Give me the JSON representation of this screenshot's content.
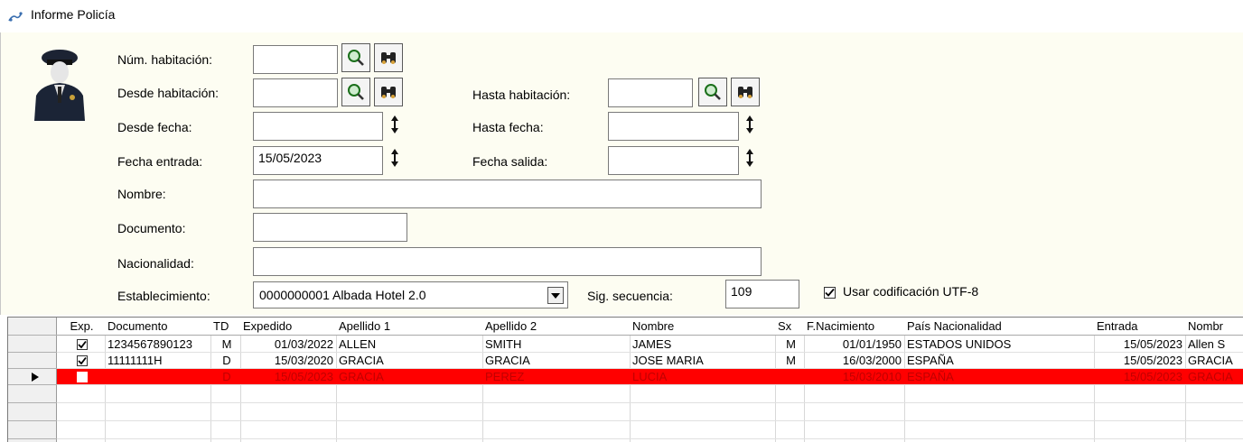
{
  "window": {
    "title": "Informe Policía"
  },
  "form": {
    "labels": {
      "num_habitacion": "Núm. habitación:",
      "desde_habitacion": "Desde habitación:",
      "hasta_habitacion": "Hasta habitación:",
      "desde_fecha": "Desde fecha:",
      "hasta_fecha": "Hasta fecha:",
      "fecha_entrada": "Fecha entrada:",
      "fecha_salida": "Fecha salida:",
      "nombre": "Nombre:",
      "documento": "Documento:",
      "nacionalidad": "Nacionalidad:",
      "establecimiento": "Establecimiento:",
      "sig_secuencia": "Sig. secuencia:",
      "usar_utf8": "Usar codificación UTF-8"
    },
    "values": {
      "num_habitacion": "",
      "desde_habitacion": "",
      "hasta_habitacion": "",
      "desde_fecha": "",
      "hasta_fecha": "",
      "fecha_entrada": "15/05/2023",
      "fecha_salida": "",
      "nombre": "",
      "documento": "",
      "nacionalidad": "",
      "establecimiento": "0000000001 Albada Hotel 2.0",
      "sig_secuencia": "109",
      "usar_utf8": true
    }
  },
  "grid": {
    "columns": [
      "Exp.",
      "Documento",
      "TD",
      "Expedido",
      "Apellido 1",
      "Apellido 2",
      "Nombre",
      "Sx",
      "F.Nacimiento",
      "País Nacionalidad",
      "Entrada",
      "Nombr"
    ],
    "rows": [
      {
        "exp": true,
        "documento": "1234567890123",
        "td": "M",
        "expedido": "01/03/2022",
        "apellido1": "ALLEN",
        "apellido2": "SMITH",
        "nombre": "JAMES",
        "sx": "M",
        "fnacimiento": "01/01/1950",
        "pais": "ESTADOS UNIDOS",
        "entrada": "15/05/2023",
        "nombre2": "Allen S",
        "current": false,
        "highlight": false
      },
      {
        "exp": true,
        "documento": "11111111H",
        "td": "D",
        "expedido": "15/03/2020",
        "apellido1": "GRACIA",
        "apellido2": "GRACIA",
        "nombre": "JOSE MARIA",
        "sx": "M",
        "fnacimiento": "16/03/2000",
        "pais": "ESPAÑA",
        "entrada": "15/05/2023",
        "nombre2": "GRACIA",
        "current": false,
        "highlight": false
      },
      {
        "exp": false,
        "documento": "",
        "td": "D",
        "expedido": "15/05/2023",
        "apellido1": "GRACIA",
        "apellido2": "PEREZ",
        "nombre": "LUCIA",
        "sx": "",
        "fnacimiento": "15/03/2010",
        "pais": "ESPAÑA",
        "entrada": "15/05/2023",
        "nombre2": "GRACIA",
        "current": true,
        "highlight": true
      }
    ],
    "highlight_color": "#ff0000",
    "highlight_text_color": "#c00000"
  },
  "icons": {
    "search": "magnifier-icon",
    "find": "binoculars-icon",
    "spin": "up-down-arrows-icon",
    "app": "app-icon",
    "officer": "police-officer-icon"
  }
}
